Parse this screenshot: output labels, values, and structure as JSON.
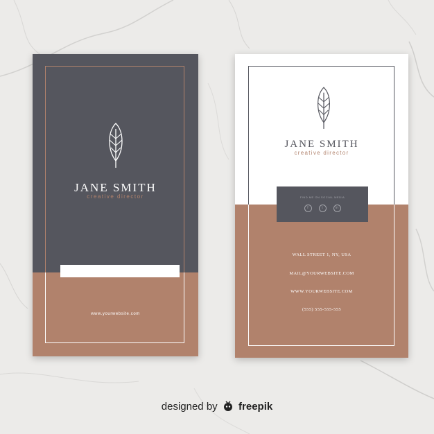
{
  "colors": {
    "charcoal": "#55565e",
    "copper": "#b1826c",
    "white": "#ffffff",
    "background": "#ecebe9"
  },
  "front_card": {
    "name": "JANE SMITH",
    "title": "creative director",
    "website": "www.yourwebsite.com",
    "logo_icon": "leaf-icon"
  },
  "back_card": {
    "name": "JANE SMITH",
    "title": "creative director",
    "logo_icon": "leaf-icon",
    "social": {
      "label": "FIND ME ON SOCIAL MEDIA",
      "icons": [
        "facebook-icon",
        "twitter-icon",
        "linkedin-icon"
      ],
      "glyphs": [
        "f",
        "t",
        "in"
      ]
    },
    "contact": {
      "address": "WALL STREET 1, NY, USA",
      "mail": "MAIL@YOURWEBSITE.COM",
      "website": "WWW.YOURWEBSITE.COM",
      "phone": "(555) 555-555-555"
    }
  },
  "footer": {
    "prefix": "designed by",
    "brand": "freepik",
    "brand_icon": "freepik-logo-icon"
  }
}
